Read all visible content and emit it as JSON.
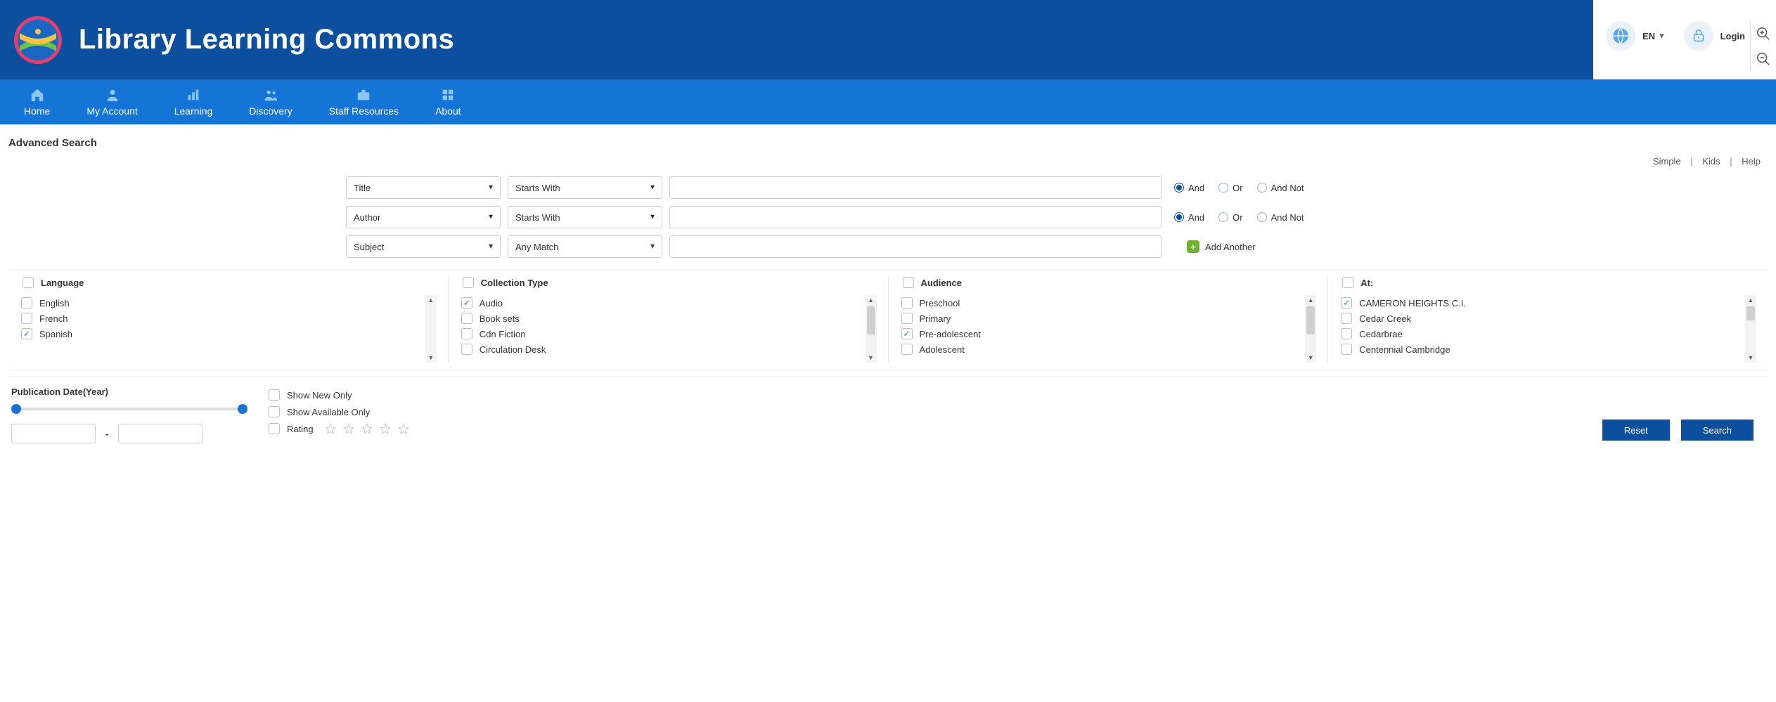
{
  "header": {
    "site_title": "Library Learning Commons",
    "lang": "EN",
    "login": "Login"
  },
  "nav": [
    {
      "label": "Home"
    },
    {
      "label": "My Account"
    },
    {
      "label": "Learning"
    },
    {
      "label": "Discovery"
    },
    {
      "label": "Staff Resources"
    },
    {
      "label": "About"
    }
  ],
  "page": {
    "title": "Advanced Search",
    "links": {
      "simple": "Simple",
      "kids": "Kids",
      "help": "Help"
    }
  },
  "search_rows": [
    {
      "field": "Title",
      "condition": "Starts With",
      "value": "",
      "op": "And",
      "ops": [
        "And",
        "Or",
        "And Not"
      ]
    },
    {
      "field": "Author",
      "condition": "Starts With",
      "value": "",
      "op": "And",
      "ops": [
        "And",
        "Or",
        "And Not"
      ]
    },
    {
      "field": "Subject",
      "condition": "Any Match",
      "value": ""
    }
  ],
  "add_another": "Add Another",
  "facets": {
    "language": {
      "label": "Language",
      "items": [
        {
          "label": "English",
          "checked": false
        },
        {
          "label": "French",
          "checked": false
        },
        {
          "label": "Spanish",
          "checked": true
        }
      ]
    },
    "collection_type": {
      "label": "Collection Type",
      "items": [
        {
          "label": "Audio",
          "checked": true
        },
        {
          "label": "Book sets",
          "checked": false
        },
        {
          "label": "Cdn Fiction",
          "checked": false
        },
        {
          "label": "Circulation Desk",
          "checked": false
        }
      ]
    },
    "audience": {
      "label": "Audience",
      "items": [
        {
          "label": "Preschool",
          "checked": false
        },
        {
          "label": "Primary",
          "checked": false
        },
        {
          "label": "Pre-adolescent",
          "checked": true
        },
        {
          "label": "Adolescent",
          "checked": false
        }
      ]
    },
    "at": {
      "label": "At:",
      "items": [
        {
          "label": "CAMERON HEIGHTS C.I.",
          "checked": true
        },
        {
          "label": "Cedar Creek",
          "checked": false
        },
        {
          "label": "Cedarbrae",
          "checked": false
        },
        {
          "label": "Centennial Cambridge",
          "checked": false
        }
      ]
    }
  },
  "bottom": {
    "pub_label": "Publication Date(Year)",
    "year_from": "",
    "year_to": "",
    "show_new": "Show New Only",
    "show_available": "Show Available Only",
    "rating": "Rating",
    "reset": "Reset",
    "search": "Search"
  }
}
